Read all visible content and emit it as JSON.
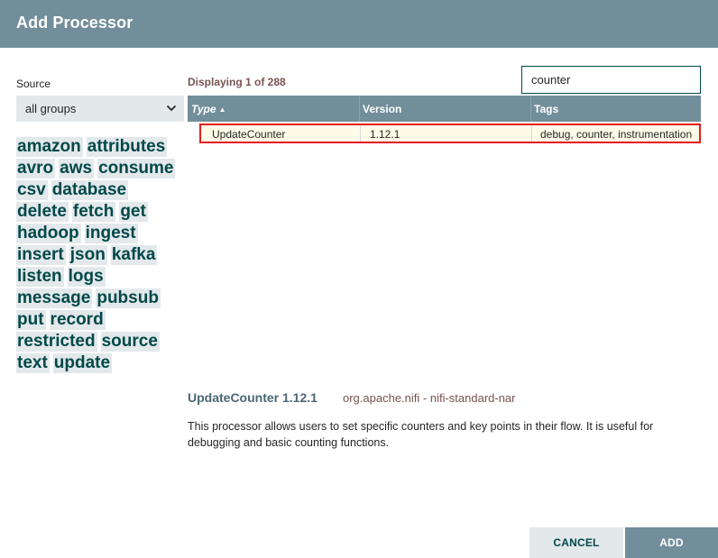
{
  "dialog": {
    "title": "Add Processor"
  },
  "source": {
    "label": "Source",
    "selected": "all groups"
  },
  "tag_cloud": [
    [
      "amazon",
      "attributes"
    ],
    [
      "avro",
      "aws",
      "consume"
    ],
    [
      "csv",
      "database"
    ],
    [
      "delete",
      "fetch",
      "get"
    ],
    [
      "hadoop",
      "ingest"
    ],
    [
      "insert",
      "json",
      "kafka"
    ],
    [
      "listen",
      "logs"
    ],
    [
      "message",
      "pubsub"
    ],
    [
      "put",
      "record"
    ],
    [
      "restricted",
      "source"
    ],
    [
      "text",
      "update"
    ]
  ],
  "listing": {
    "displaying_text": "Displaying 1 of 288"
  },
  "search": {
    "value": "counter"
  },
  "table": {
    "columns": {
      "type": "Type",
      "version": "Version",
      "tags": "Tags"
    },
    "rows": [
      {
        "type": "UpdateCounter",
        "version": "1.12.1",
        "tags": "debug, counter, instrumentation"
      }
    ]
  },
  "details": {
    "name": "UpdateCounter 1.12.1",
    "bundle": "org.apache.nifi - nifi-standard-nar",
    "description": "This processor allows users to set specific counters and key points in their flow. It is useful for debugging and basic counting functions."
  },
  "footer": {
    "cancel_label": "CANCEL",
    "add_label": "ADD"
  },
  "colors": {
    "header": "#728e9b",
    "tag_bg": "#e3e8eb",
    "tag_text": "#004849",
    "selected_row_border": "#e31c1c",
    "selected_row_bg": "#fdfbe7"
  }
}
